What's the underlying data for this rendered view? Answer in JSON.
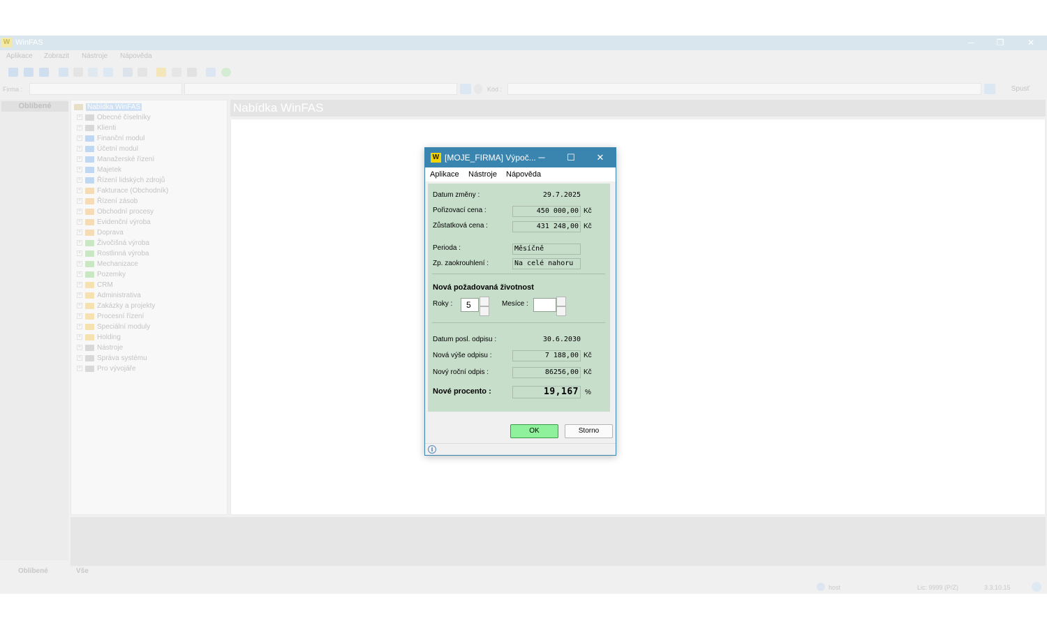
{
  "main": {
    "title": "WinFAS",
    "menu": [
      "Aplikace",
      "Zobrazit",
      "Nástroje",
      "Nápověda"
    ],
    "firma_label": "Firma :",
    "kod_label": "Kód :",
    "spust_label": "Spusť",
    "favorites_title": "Oblíbené",
    "content_title": "Nabídka WinFAS",
    "tree_root": "Nabídka WinFAS",
    "tree_items": [
      {
        "label": "Obecné číselníky",
        "color": "#d8d8d8"
      },
      {
        "label": "Klienti",
        "color": "#d8d8d8"
      },
      {
        "label": "Finanční modul",
        "color": "#bfd7f0"
      },
      {
        "label": "Účetní modul",
        "color": "#bfd7f0"
      },
      {
        "label": "Manažerské řízení",
        "color": "#bfd7f0"
      },
      {
        "label": "Majetek",
        "color": "#bfd7f0"
      },
      {
        "label": "Řízení lidských zdrojů",
        "color": "#bfd7f0"
      },
      {
        "label": "Fakturace (Obchodník)",
        "color": "#f6dcb5"
      },
      {
        "label": "Řízení zásob",
        "color": "#f6dcb5"
      },
      {
        "label": "Obchodní procesy",
        "color": "#f6dcb5"
      },
      {
        "label": "Evidenční výroba",
        "color": "#f6dcb5"
      },
      {
        "label": "Doprava",
        "color": "#f6dcb5"
      },
      {
        "label": "Živočišná výroba",
        "color": "#c9e7c3"
      },
      {
        "label": "Rostlinná výroba",
        "color": "#c9e7c3"
      },
      {
        "label": "Mechanizace",
        "color": "#c9e7c3"
      },
      {
        "label": "Pozemky",
        "color": "#c9e7c3"
      },
      {
        "label": "CRM",
        "color": "#f6e1b0"
      },
      {
        "label": "Administrativa",
        "color": "#f6e1b0"
      },
      {
        "label": "Zakázky a projekty",
        "color": "#f6e1b0"
      },
      {
        "label": "Procesní řízení",
        "color": "#f6e1b0"
      },
      {
        "label": "Speciální moduly",
        "color": "#f6e1b0"
      },
      {
        "label": "Holding",
        "color": "#f6e1b0"
      },
      {
        "label": "Nástroje",
        "color": "#d8d8d8"
      },
      {
        "label": "Správa systému",
        "color": "#d8d8d8"
      },
      {
        "label": "Pro vývojáře",
        "color": "#d8d8d8"
      }
    ],
    "bottom_tabs": [
      "Oblíbené",
      "Vše"
    ],
    "status": {
      "user": "host",
      "license": "Lic: 9999 (P/Z)",
      "version": "3.3.10.15"
    }
  },
  "dialog": {
    "title": "[MOJE_FIRMA] Výpoč...",
    "menu": [
      "Aplikace",
      "Nástroje",
      "Nápověda"
    ],
    "datum_zmeny_label": "Datum změny :",
    "datum_zmeny": "29.7.2025",
    "porizovaci_cena_label": "Pořizovací cena :",
    "porizovaci_cena": "450 000,00",
    "zustatkova_cena_label": "Zůstatková cena :",
    "zustatkova_cena": "431 248,00",
    "currency": "Kč",
    "perioda_label": "Perioda :",
    "perioda": "Měsíčně",
    "zaokrouhleni_label": "Zp. zaokrouhlení :",
    "zaokrouhleni": "Na celé nahoru",
    "section_title": "Nová požadovaná životnost",
    "roky_label": "Roky :",
    "roky": "5",
    "mesice_label": "Mesíce :",
    "mesice": "",
    "datum_posl_label": "Datum posl. odpisu :",
    "datum_posl": "30.6.2030",
    "nova_vyse_label": "Nová výše odpisu :",
    "nova_vyse": "7 188,00",
    "novy_rocni_label": "Nový roční odpis :",
    "novy_rocni": "86256,00",
    "nove_procento_label": "Nové procento :",
    "nove_procento": "19,167",
    "percent_unit": "%",
    "ok_label": "OK",
    "cancel_label": "Storno"
  }
}
